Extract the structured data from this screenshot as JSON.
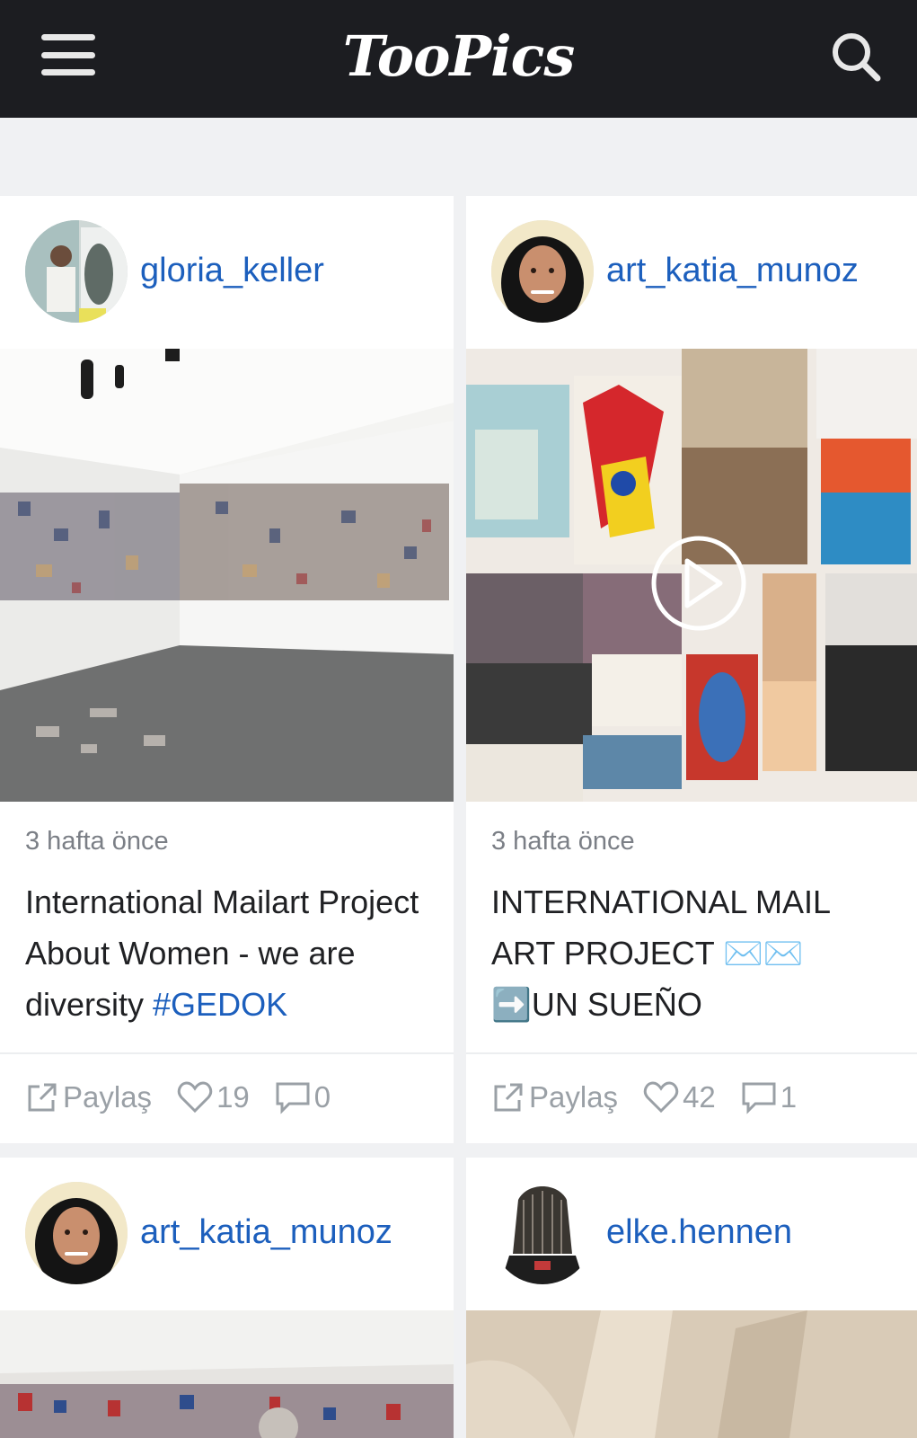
{
  "app": {
    "title": "TooPics"
  },
  "icons": {
    "menu": "hamburger-menu-icon",
    "search": "search-icon",
    "share": "share-icon",
    "like": "heart-icon",
    "comment": "comment-icon",
    "play": "play-icon"
  },
  "colors": {
    "topbar": "#1c1d21",
    "link": "#1c5fbd",
    "muted": "#9aa0a6"
  },
  "posts": [
    {
      "username": "gloria_keller",
      "time": "3 hafta önce",
      "caption": "International Mailart Project About Women - we are diversity ",
      "hashtag": "#GEDOK",
      "share_label": "Paylaş",
      "likes": "19",
      "comments": "0"
    },
    {
      "username": "art_katia_munoz",
      "time": "3 hafta önce",
      "caption": "INTERNATIONAL MAIL ART PROJECT ✉️✉️ ➡️UN SUEÑO",
      "share_label": "Paylaş",
      "likes": "42",
      "comments": "1"
    },
    {
      "username": "art_katia_munoz"
    },
    {
      "username": "elke.hennen"
    }
  ]
}
